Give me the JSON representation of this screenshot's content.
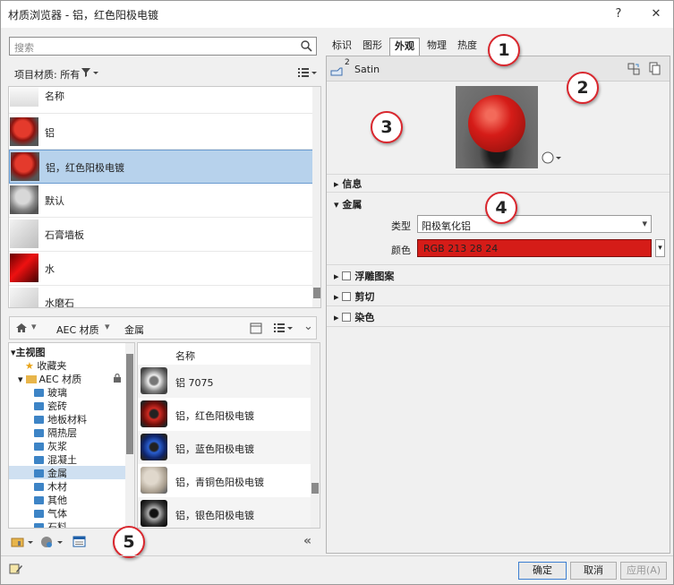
{
  "window": {
    "title": "材质浏览器 - 铝，红色阳极电镀",
    "help": "?",
    "close": "✕"
  },
  "search": {
    "placeholder": "搜索"
  },
  "project_materials": {
    "label": "项目材质: 所有"
  },
  "material_list": {
    "header": "名称",
    "items": [
      {
        "label": "铝"
      },
      {
        "label": "铝，红色阳极电镀"
      },
      {
        "label": "默认"
      },
      {
        "label": "石膏墙板"
      },
      {
        "label": "水"
      },
      {
        "label": "水磨石"
      }
    ]
  },
  "breadcrumb": {
    "root": "AEC 材质",
    "child": "金属"
  },
  "tree": {
    "root": "主视图",
    "favorites": "收藏夹",
    "aec": "AEC 材质",
    "children": [
      "玻璃",
      "瓷砖",
      "地板材料",
      "隔热层",
      "灰浆",
      "混凝土",
      "金属",
      "木材",
      "其他",
      "气体",
      "石料"
    ]
  },
  "library_list": {
    "header": "名称",
    "items": [
      {
        "label": "铝 7075"
      },
      {
        "label": "铝，红色阳极电镀"
      },
      {
        "label": "铝，蓝色阳极电镀"
      },
      {
        "label": "铝，青铜色阳极电镀"
      },
      {
        "label": "铝，银色阳极电镀"
      }
    ]
  },
  "tabs": [
    "标识",
    "图形",
    "外观",
    "物理",
    "热度"
  ],
  "active_tab": "外观",
  "appearance": {
    "asset_count": "2",
    "asset_name": "Satin",
    "info_label": "信息",
    "metal_label": "金属",
    "type_label": "类型",
    "type_value": "阳极氧化铝",
    "color_label": "颜色",
    "color_value": "RGB 213 28 24",
    "color_hex": "#d51c18",
    "relief_label": "浮雕图案",
    "cutout_label": "剪切",
    "tint_label": "染色"
  },
  "callouts": [
    "1",
    "2",
    "3",
    "4",
    "5"
  ],
  "buttons": {
    "ok": "确定",
    "cancel": "取消",
    "apply": "应用(A)"
  }
}
